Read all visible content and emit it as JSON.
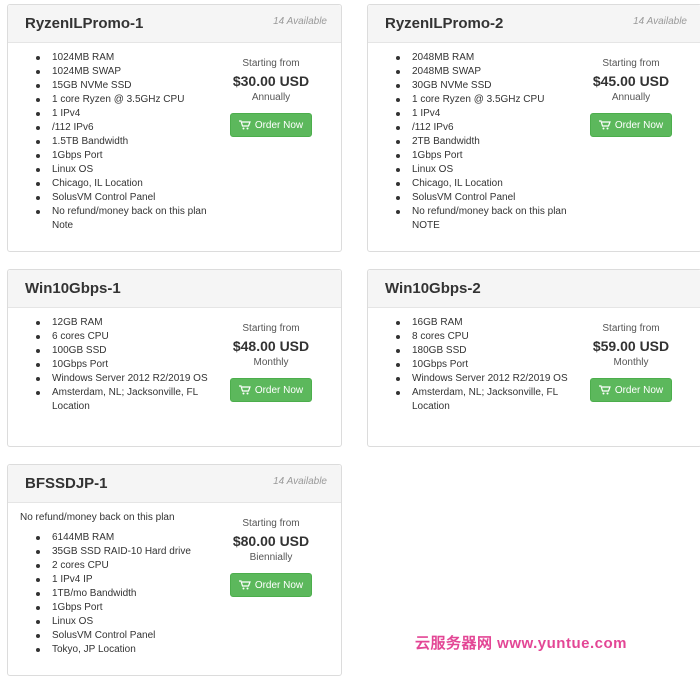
{
  "cards": [
    {
      "title": "RyzenILPromo-1",
      "available": "14 Available",
      "features": [
        "1024MB RAM",
        "1024MB SWAP",
        "15GB NVMe SSD",
        "1 core Ryzen @ 3.5GHz CPU",
        "1 IPv4",
        "/112 IPv6",
        "1.5TB Bandwidth",
        "1Gbps Port",
        "Linux OS",
        "Chicago, IL Location",
        "SolusVM Control Panel",
        "No refund/money back on this plan Note"
      ],
      "price": {
        "label": "Starting from",
        "amount": "$30.00 USD",
        "cycle": "Annually"
      },
      "button": "Order Now"
    },
    {
      "title": "RyzenILPromo-2",
      "available": "14 Available",
      "features": [
        "2048MB RAM",
        "2048MB SWAP",
        "30GB NVMe SSD",
        "1 core Ryzen @ 3.5GHz CPU",
        "1 IPv4",
        "/112 IPv6",
        "2TB Bandwidth",
        "1Gbps Port",
        "Linux OS",
        "Chicago, IL Location",
        "SolusVM Control Panel",
        "No refund/money back on this plan NOTE"
      ],
      "price": {
        "label": "Starting from",
        "amount": "$45.00 USD",
        "cycle": "Annually"
      },
      "button": "Order Now"
    },
    {
      "title": "Win10Gbps-1",
      "features": [
        "12GB RAM",
        "6 cores CPU",
        "100GB SSD",
        "10Gbps Port",
        "Windows Server 2012 R2/2019 OS",
        "Amsterdam, NL; Jacksonville, FL Location"
      ],
      "price": {
        "label": "Starting from",
        "amount": "$48.00 USD",
        "cycle": "Monthly"
      },
      "button": "Order Now"
    },
    {
      "title": "Win10Gbps-2",
      "features": [
        "16GB RAM",
        "8 cores CPU",
        "180GB SSD",
        "10Gbps Port",
        "Windows Server 2012 R2/2019 OS",
        "Amsterdam, NL; Jacksonville, FL Location"
      ],
      "price": {
        "label": "Starting from",
        "amount": "$59.00 USD",
        "cycle": "Monthly"
      },
      "button": "Order Now"
    },
    {
      "title": "BFSSDJP-1",
      "available": "14 Available",
      "note": "No refund/money back on this plan",
      "features": [
        "6144MB RAM",
        "35GB SSD RAID-10 Hard drive",
        "2 cores CPU",
        "1 IPv4 IP",
        "1TB/mo Bandwidth",
        "1Gbps Port",
        "Linux OS",
        "SolusVM Control Panel",
        "Tokyo, JP Location"
      ],
      "price": {
        "label": "Starting from",
        "amount": "$80.00 USD",
        "cycle": "Biennially"
      },
      "button": "Order Now"
    }
  ],
  "watermark": "云服务器网 www.yuntue.com",
  "colors": {
    "button": "#5cb85c",
    "watermark": "#e0338a"
  },
  "icons": {
    "button": "shopping-cart-icon"
  }
}
